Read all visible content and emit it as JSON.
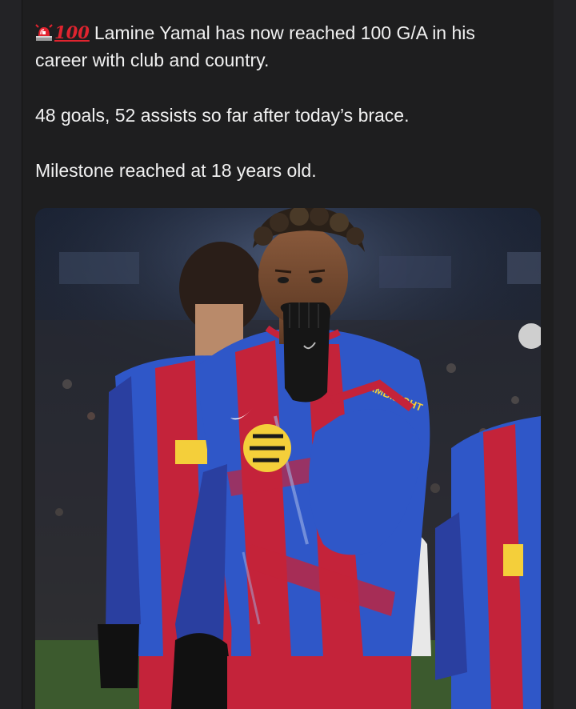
{
  "post": {
    "emoji_icons": [
      "rotating-light-emoji",
      "hundred-points-emoji"
    ],
    "hundred_glyph": "100",
    "line1": "Lamine Yamal has now reached 100 G/A in his career with club and country.",
    "line2": "48 goals, 52 assists so far after today’s brace.",
    "line3": "Milestone reached at 18 years old."
  },
  "photo": {
    "jersey_sponsor_text": "AMBILIGHT",
    "colors": {
      "blue": "#2f57c8",
      "red": "#c4233a",
      "yellow": "#f4cf3a",
      "pitch": "#3c5a2e"
    }
  }
}
